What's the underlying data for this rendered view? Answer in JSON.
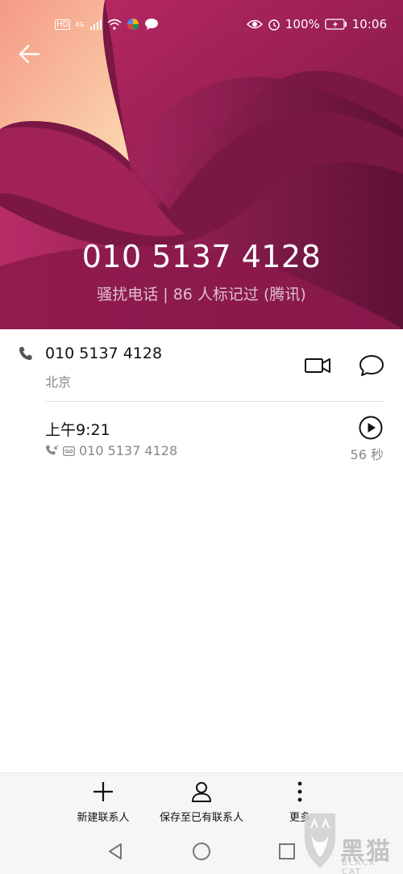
{
  "status_bar": {
    "left_badges": [
      "HD",
      "4G"
    ],
    "battery": "100%",
    "time": "10:06",
    "icons": [
      "signal-icon",
      "wifi-icon",
      "app-icon",
      "chat-bubble-icon",
      "eye-icon",
      "alarm-icon",
      "battery-icon"
    ]
  },
  "header": {
    "phone_number": "010 5137 4128",
    "tag_line": "骚扰电话 | 86 人标记过 (腾讯)",
    "colors": {
      "dark": "#6a123a",
      "mid": "#9a1c53",
      "light": "#f5c9a6"
    }
  },
  "detail": {
    "number": "010 5137 4128",
    "location": "北京"
  },
  "call_log": {
    "time": "上午9:21",
    "number": "010 5137 4128",
    "duration": "56 秒"
  },
  "actions": {
    "new_contact": "新建联系人",
    "save_existing": "保存至已有联系人",
    "more": "更多"
  },
  "watermark": {
    "text": "黑猫",
    "sub": "BLACK CAT"
  }
}
